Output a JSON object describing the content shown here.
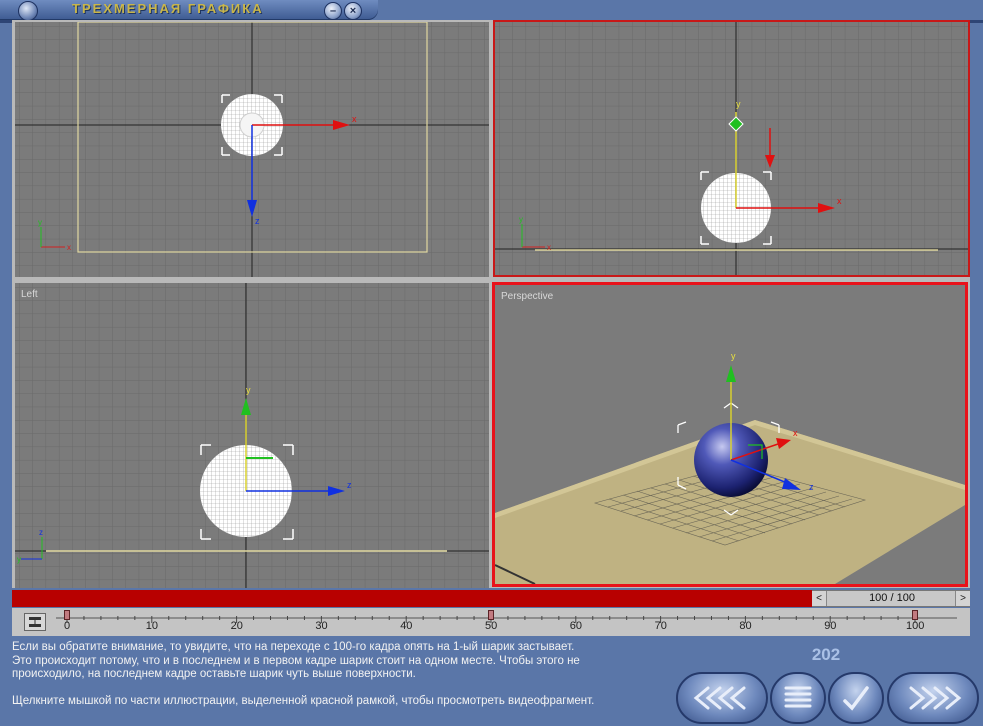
{
  "window": {
    "title": "ТРЕХМЕРНАЯ ГРАФИКА",
    "minimize_glyph": "–",
    "close_glyph": "×"
  },
  "viewports": [
    {
      "id": "top",
      "label": "",
      "active": false
    },
    {
      "id": "front",
      "label": "",
      "active": false
    },
    {
      "id": "left",
      "label": "Left",
      "active": false
    },
    {
      "id": "perspective",
      "label": "Perspective",
      "active": true
    }
  ],
  "axis_labels": {
    "x": "x",
    "y": "y",
    "z": "z"
  },
  "timeline": {
    "frame_counter": "100 / 100",
    "current_frame": 100,
    "total_frames": 100,
    "tick_labels": [
      "0",
      "10",
      "20",
      "30",
      "40",
      "50",
      "60",
      "70",
      "80",
      "90",
      "100"
    ],
    "keyframes": [
      0,
      50,
      100
    ],
    "left_arrow": "<",
    "right_arrow": ">"
  },
  "description": {
    "line1": "Если вы обратите внимание, то увидите, что на переходе с 100-го кадра опять на 1-ый шарик застывает.",
    "line2": "Это происходит потому, что и в последнем и в первом кадре шарик стоит на одном месте. Чтобы этого не",
    "line3": "происходило, на последнем кадре оставьте шарик чуть выше поверхности.",
    "line4": "Щелкните мышкой по части иллюстрации, выделенной красной рамкой, чтобы просмотреть видеофрагмент."
  },
  "page_number": "202",
  "nav": {
    "back_icon": "rewind-icon",
    "menu_icon": "menu-icon",
    "check_icon": "check-icon",
    "forward_icon": "fast-forward-icon"
  },
  "colors": {
    "viewport_bg": "#7b7b7b",
    "active_border": "#e8121a",
    "timebar": "#b80000",
    "title_text": "#c9b64a",
    "page_number": "#a9c0e6"
  }
}
